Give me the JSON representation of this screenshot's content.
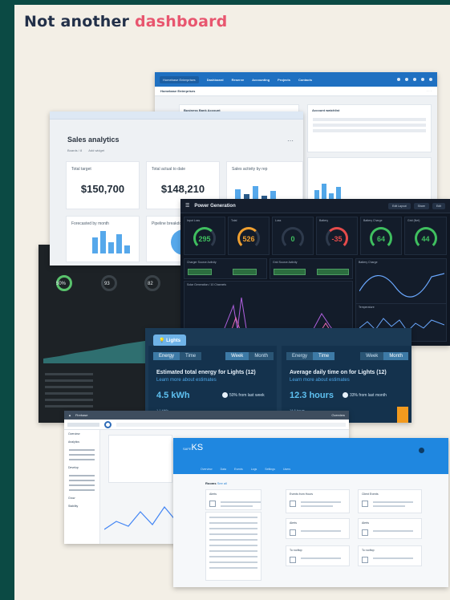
{
  "headline": {
    "prefix": "Not another",
    "accent": "dashboard"
  },
  "shot_top": {
    "org_chip": "Homebase Enterprises",
    "nav": [
      "Dashboard",
      "Reserve",
      "Accounting",
      "Projects",
      "Contacts"
    ],
    "page": "Homebase Enterprises",
    "card_left": "Business Bank Account",
    "card_right": "Account watchlist"
  },
  "sales": {
    "title": "Sales analytics",
    "subnav": [
      "Boards / 8",
      "Add widget"
    ],
    "kpis": [
      {
        "label": "Total target",
        "value": "$150,700"
      },
      {
        "label": "Total actual to date",
        "value": "$148,210"
      },
      {
        "label": "Sales activity by rep",
        "value": ""
      }
    ],
    "lower": [
      {
        "label": "Forecasted by month"
      },
      {
        "label": "Pipeline breakdown"
      }
    ]
  },
  "dark_left": {
    "gauges": [
      "50%",
      "93",
      "82"
    ]
  },
  "power": {
    "title": "Power Generation",
    "buttons": [
      "Edit Layout",
      "Share",
      "Edit"
    ],
    "panels": [
      {
        "label": "Input Loss",
        "value": "295",
        "color": "#3fbf5f"
      },
      {
        "label": "Total",
        "value": "526",
        "color": "#f0a030"
      },
      {
        "label": "Loss",
        "value": "0",
        "color": "#3fbf5f"
      },
      {
        "label": "Battery",
        "value": "-35",
        "color": "#e54b4b"
      },
      {
        "label": "Battery Charge",
        "value": "64",
        "color": "#3fbf5f"
      },
      {
        "label": "Grid (Net)",
        "value": "44",
        "color": "#3fbf5f"
      }
    ],
    "mid_labels": [
      "Charger Source Activity",
      "Grid Source Activity",
      "Battery Charge"
    ],
    "big_labels": [
      "Solar Generation / 10 Channels",
      "Temperature"
    ]
  },
  "energy": {
    "tab": "Lights",
    "left": {
      "seg_left": [
        "Energy",
        "Time"
      ],
      "seg_right": [
        "Week",
        "Month"
      ],
      "heading": "Estimated total energy for Lights (12)",
      "link": "Learn more about estimates",
      "value": "4.5 kWh",
      "compare": "50% from last week",
      "foot": "1.1 kWh"
    },
    "right": {
      "seg_left": [
        "Energy",
        "Time"
      ],
      "seg_right": [
        "Week",
        "Month"
      ],
      "heading": "Average daily time on for Lights (12)",
      "link": "Learn more about estimates",
      "value": "12.3 hours",
      "compare": "33% from last month",
      "foot": "14.6 hours"
    }
  },
  "firebase": {
    "toolbar": [
      "Firebase",
      "Overview"
    ],
    "sidebar": [
      "Overview",
      "Analytics",
      "Develop",
      "Grow",
      "Stability"
    ]
  },
  "ks": {
    "logo_prefix": "SAFE",
    "logo": "KS",
    "nav": [
      "Overview",
      "Data",
      "Events",
      "Logs",
      "Settings",
      "Users"
    ],
    "section": "Rooms",
    "section_link": "See all",
    "tiles": [
      "Alerts",
      "Events from Hours",
      "Client Events",
      "Alerts",
      "To rooftop",
      "To rooftop"
    ]
  }
}
